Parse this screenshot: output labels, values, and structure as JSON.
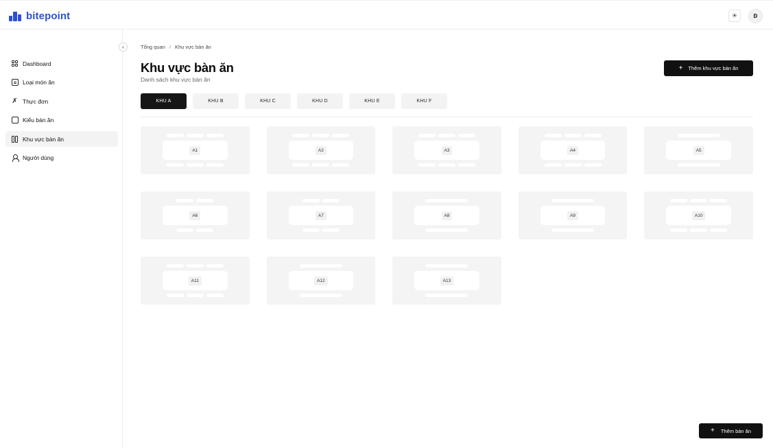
{
  "app": {
    "name": "bitepoint",
    "brand_color": "#2d4fd6"
  },
  "header": {
    "theme_icon": "sun-icon",
    "avatar_initial": "Đ"
  },
  "sidebar": {
    "items": [
      {
        "label": "Dashboard",
        "icon": "dashboard-grid-icon"
      },
      {
        "label": "Loại món ăn",
        "icon": "list-icon"
      },
      {
        "label": "Thực đơn",
        "icon": "utensils-icon"
      },
      {
        "label": "Kiểu bàn ăn",
        "icon": "square-icon"
      },
      {
        "label": "Khu vực bàn ăn",
        "icon": "split-layout-icon",
        "active": true
      },
      {
        "label": "Người dùng",
        "icon": "user-icon"
      }
    ]
  },
  "breadcrumb": {
    "root": "Tổng quan",
    "separator": "/",
    "current": "Khu vực bàn ăn"
  },
  "page": {
    "title": "Khu vực bàn ăn",
    "subtitle": "Danh sách khu vực bàn ăn",
    "add_area_label": "Thêm khu vực bàn ăn",
    "add_table_label": "Thêm bàn ăn"
  },
  "tabs": [
    {
      "label": "KHU A",
      "active": true
    },
    {
      "label": "KHU B"
    },
    {
      "label": "KHU C"
    },
    {
      "label": "KHU D"
    },
    {
      "label": "KHU E"
    },
    {
      "label": "KHU F"
    }
  ],
  "tables": [
    {
      "label": "A1",
      "top_seats": 3,
      "bottom_seats": 3
    },
    {
      "label": "A2",
      "top_seats": 3,
      "bottom_seats": 3
    },
    {
      "label": "A3",
      "top_seats": 3,
      "bottom_seats": 3
    },
    {
      "label": "A4",
      "top_seats": 3,
      "bottom_seats": 3
    },
    {
      "label": "A5",
      "top_seats": 1,
      "bottom_seats": 1
    },
    {
      "label": "A6",
      "top_seats": 2,
      "bottom_seats": 2
    },
    {
      "label": "A7",
      "top_seats": 2,
      "bottom_seats": 2
    },
    {
      "label": "A8",
      "top_seats": 1,
      "bottom_seats": 1
    },
    {
      "label": "A9",
      "top_seats": 1,
      "bottom_seats": 1
    },
    {
      "label": "A10",
      "top_seats": 3,
      "bottom_seats": 3
    },
    {
      "label": "A11",
      "top_seats": 3,
      "bottom_seats": 3
    },
    {
      "label": "A12",
      "top_seats": 1,
      "bottom_seats": 1
    },
    {
      "label": "A13",
      "top_seats": 1,
      "bottom_seats": 1
    }
  ]
}
